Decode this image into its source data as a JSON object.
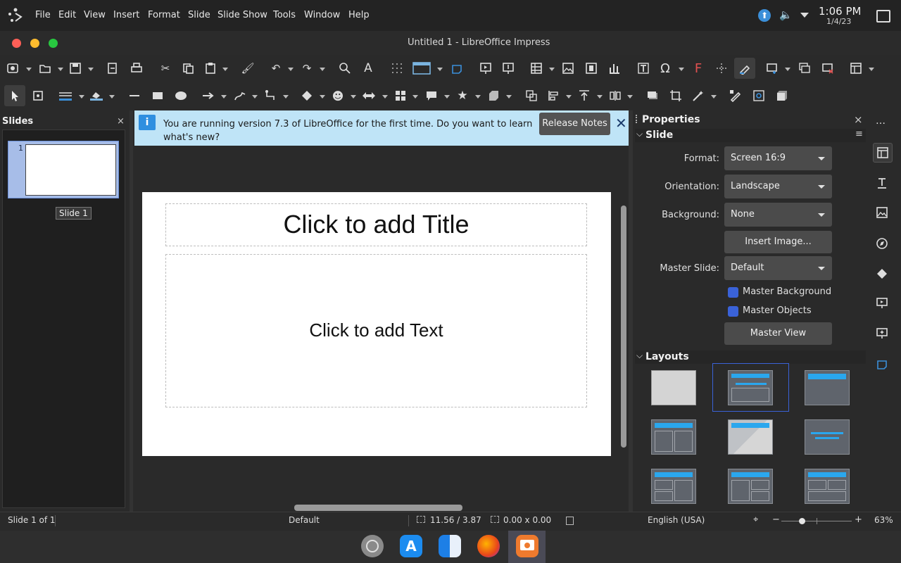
{
  "menu": [
    "File",
    "Edit",
    "View",
    "Insert",
    "Format",
    "Slide",
    "Slide Show",
    "Tools",
    "Window",
    "Help"
  ],
  "clock": {
    "time": "1:06 PM",
    "date": "1/4/23"
  },
  "window_title": "Untitled 1 - LibreOffice Impress",
  "slides_panel": {
    "title": "Slides",
    "slide_number": "1",
    "tooltip": "Slide 1"
  },
  "infobar": {
    "message_line1": "You are running version 7.3 of LibreOffice for the first time. Do you want to learn",
    "message_line2": "what's new?",
    "button": "Release Notes"
  },
  "slide": {
    "title_placeholder": "Click to add Title",
    "text_placeholder": "Click to add Text"
  },
  "properties": {
    "title": "Properties",
    "slide_section": "Slide",
    "format_label": "Format:",
    "format_value": "Screen 16:9",
    "orientation_label": "Orientation:",
    "orientation_value": "Landscape",
    "background_label": "Background:",
    "background_value": "None",
    "insert_image": "Insert Image...",
    "master_slide_label": "Master Slide:",
    "master_slide_value": "Default",
    "master_background": "Master Background",
    "master_objects": "Master Objects",
    "master_view": "Master View",
    "layouts_section": "Layouts"
  },
  "statusbar": {
    "slide": "Slide 1 of 1",
    "master": "Default",
    "position": "11.56 / 3.87",
    "size": "0.00 x 0.00",
    "language": "English (USA)",
    "zoom": "63%"
  },
  "colors": {
    "accent": "#3a62d8",
    "infobar": "#bfe4f7",
    "layout_bar": "#2aa7ee"
  }
}
